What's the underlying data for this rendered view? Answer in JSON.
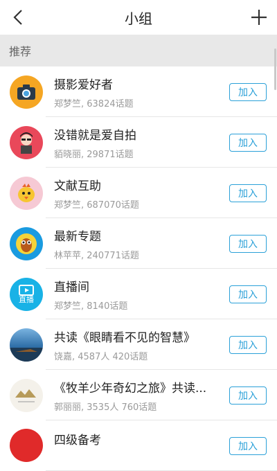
{
  "header": {
    "title": "小组",
    "back_icon": "chevron-left-icon",
    "add_icon": "plus-icon"
  },
  "section": {
    "label": "推荐"
  },
  "join_label": "加入",
  "groups": [
    {
      "name": "摄影爱好者",
      "meta": "郑梦竺, 63824话题",
      "icon": "camera-icon",
      "color": "#f5a623"
    },
    {
      "name": "没错就是爱自拍",
      "meta": "貊晓丽, 29871话题",
      "icon": "selfie-cartoon-icon",
      "color": "#e9485a"
    },
    {
      "name": "文献互助",
      "meta": "郑梦竺, 687070话题",
      "icon": "chick-cartoon-icon",
      "color": "#f6c9d4"
    },
    {
      "name": "最新专题",
      "meta": "林苹苹, 240771话题",
      "icon": "owl-cartoon-icon",
      "color": "#1a9be0"
    },
    {
      "name": "直播间",
      "meta": "郑梦竺, 8140话题",
      "icon": "tv-live-icon",
      "color": "#19b2e6",
      "icon_text": "直播"
    },
    {
      "name": "共读《眼睛看不见的智慧》",
      "meta": "饶嘉, 4587人 420话题",
      "icon": "landscape-photo-icon",
      "color": "#2f6fa8"
    },
    {
      "name": "《牧羊少年奇幻之旅》共读...",
      "meta": "郭丽丽, 3535人 760话题",
      "icon": "mountain-drawing-icon",
      "color": "#f4f1ea"
    },
    {
      "name": "四级备考",
      "meta": "",
      "icon": "red-avatar-icon",
      "color": "#e02a2a"
    }
  ]
}
